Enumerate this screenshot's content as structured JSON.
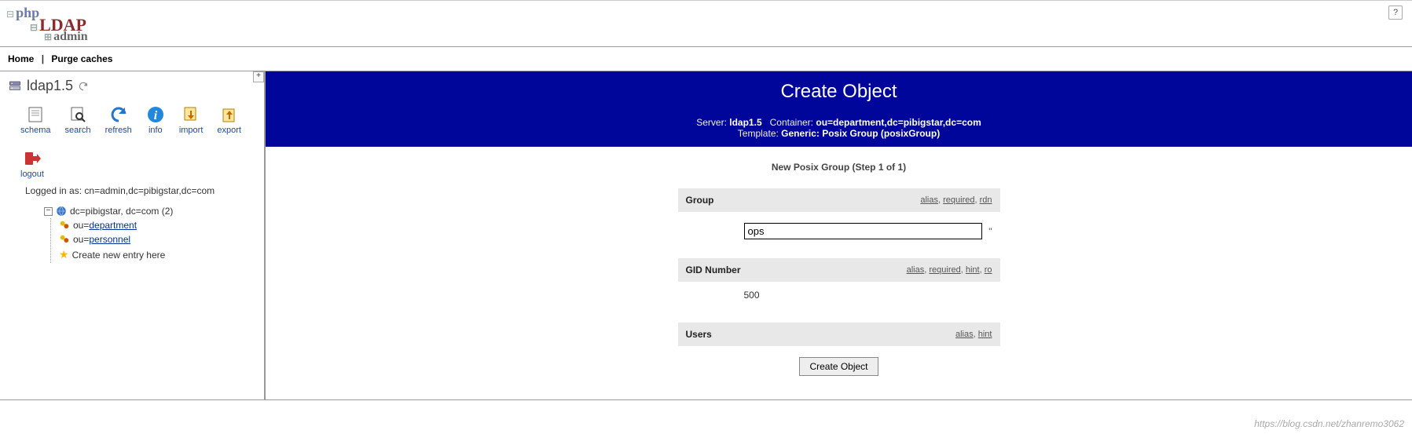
{
  "logo": {
    "line1": "php",
    "line2": "LDAP",
    "line3": "admin"
  },
  "nav": {
    "home": "Home",
    "purge": "Purge caches"
  },
  "help_tooltip": "?",
  "sidebar": {
    "server_name": "ldap1.5",
    "toolbar": [
      {
        "label": "schema"
      },
      {
        "label": "search"
      },
      {
        "label": "refresh"
      },
      {
        "label": "info"
      },
      {
        "label": "import"
      },
      {
        "label": "export"
      },
      {
        "label": "logout"
      }
    ],
    "logged_in": "Logged in as: cn=admin,dc=pibigstar,dc=com",
    "tree": {
      "root": "dc=pibigstar, dc=com (2)",
      "children": [
        {
          "label": "ou=department",
          "link_text": "department"
        },
        {
          "label": "ou=personnel",
          "link_text": "personnel"
        }
      ],
      "create_entry": "Create new entry here"
    }
  },
  "content": {
    "title": "Create Object",
    "info": {
      "server_label": "Server:",
      "server": "ldap1.5",
      "container_label": "Container:",
      "container": "ou=department,dc=pibigstar,dc=com",
      "template_label": "Template:",
      "template": "Generic: Posix Group (posixGroup)"
    },
    "step_title": "New Posix Group (Step 1 of 1)",
    "fields": {
      "group": {
        "name": "Group",
        "tags": [
          "alias",
          "required",
          "rdn"
        ],
        "value": "ops"
      },
      "gid": {
        "name": "GID Number",
        "tags": [
          "alias",
          "required",
          "hint",
          "ro"
        ],
        "value": "500"
      },
      "users": {
        "name": "Users",
        "tags": [
          "alias",
          "hint"
        ]
      }
    },
    "submit": "Create Object"
  },
  "watermark": "https://blog.csdn.net/zhanremo3062"
}
